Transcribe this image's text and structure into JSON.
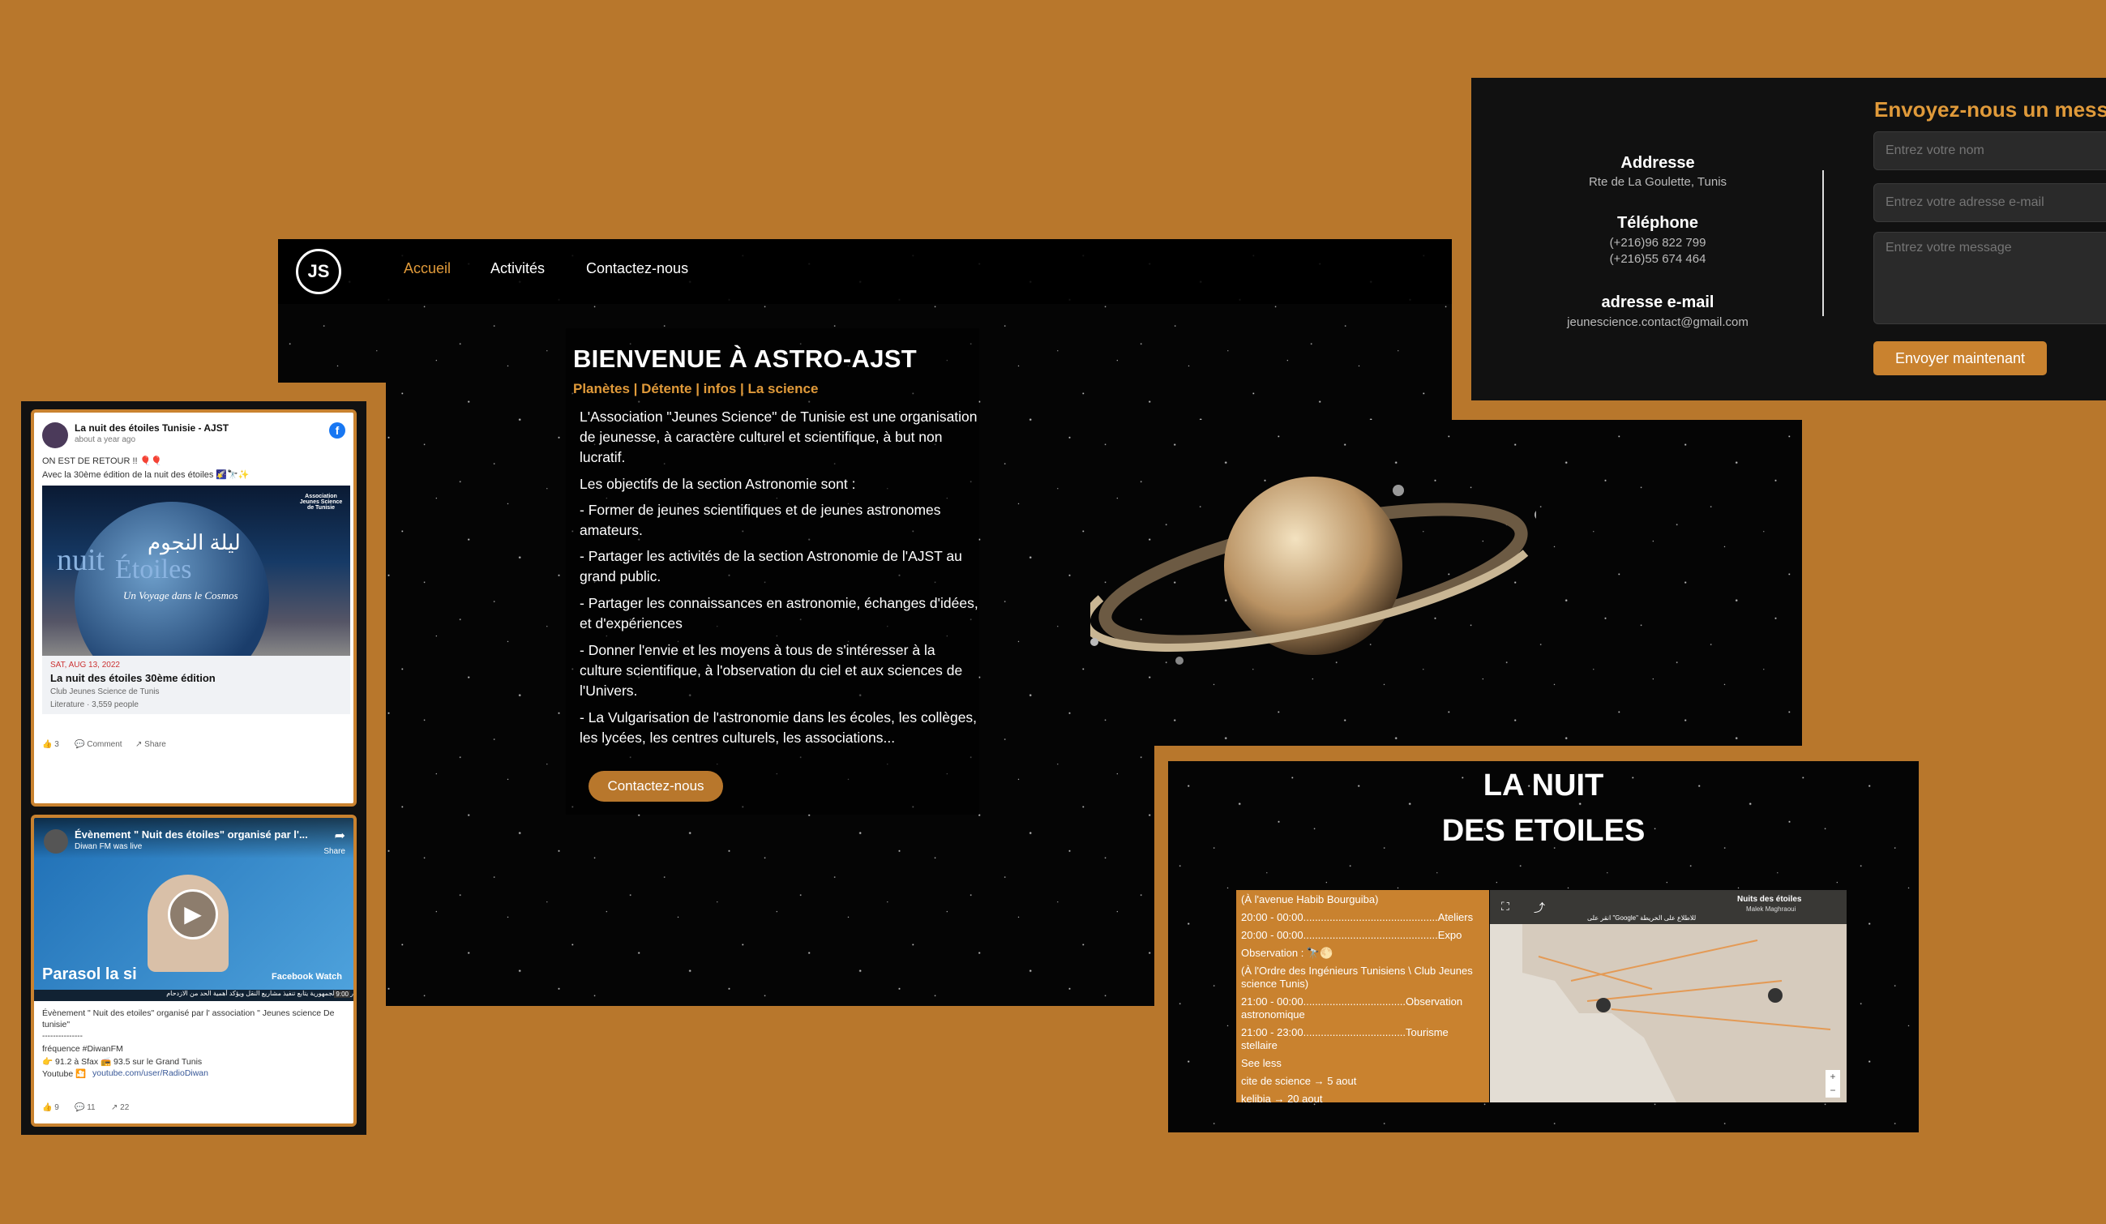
{
  "nav": {
    "logo": "JS",
    "items": [
      "Accueil",
      "Activités",
      "Contactez-nous"
    ]
  },
  "hero": {
    "title": "BIENVENUE À ASTRO-AJST",
    "tagline": "Planètes | Détente | infos | La science",
    "paragraphs": [
      "L'Association \"Jeunes Science\" de Tunisie est une organisation de jeunesse, à caractère culturel et scientifique, à but non lucratif.",
      "Les objectifs de la section Astronomie sont :",
      "- Former de jeunes scientifiques et de jeunes astronomes amateurs.",
      "- Partager les activités de la section Astronomie de l'AJST au grand public.",
      "- Partager les connaissances en astronomie, échanges d'idées, et d'expériences",
      "- Donner l'envie et les moyens à tous de s'intéresser à la culture scientifique, à l'observation du ciel et aux sciences de l'Univers.",
      "- La Vulgarisation de l'astronomie dans les écoles, les collèges, les lycées, les centres culturels, les associations..."
    ],
    "button": "Contactez-nous"
  },
  "contact": {
    "address_label": "Addresse",
    "address": "Rte de La Goulette, Tunis",
    "phone_label": "Téléphone",
    "phone1": "(+216)96 822 799",
    "phone2": "(+216)55 674 464",
    "email_label": "adresse e-mail",
    "email": "jeunescience.contact@gmail.com",
    "form_title": "Envoyez-nous un message",
    "name_placeholder": "Entrez votre nom",
    "email_placeholder": "Entrez votre adresse e-mail",
    "message_placeholder": "Entrez votre message",
    "send": "Envoyer maintenant"
  },
  "fb_post": {
    "page": "La nuit des étoiles Tunisie - AJST",
    "time": "about a year ago",
    "line1": "ON EST DE RETOUR !! 🎈🎈",
    "line2": "Avec la 30ème édition de la nuit des étoiles 🌠🔭✨",
    "img_arabic": "ليلة النجوم",
    "img_nuit": "nuit",
    "img_etoiles": "Étoiles",
    "img_sub": "Un Voyage dans le Cosmos",
    "img_assoc": "Association Jeunes Science de Tunisie",
    "date": "SAT, AUG 13, 2022",
    "event": "La nuit des étoiles 30ème édition",
    "org": "Club Jeunes Science de Tunis",
    "meta": "Literature · 3,559 people",
    "likes": "3",
    "comment": "Comment",
    "share": "Share"
  },
  "fb_video": {
    "title": "Évènement \" Nuit des étoiles\" organisé par l'...",
    "sub": "Diwan FM was live",
    "share": "Share",
    "brand": "Parasol la si",
    "watch": "Facebook Watch",
    "ticker": "رئيس الجمهورية يتابع تنفيذ مشاريع النقل ويؤكد أهمية الحد من الازدحام",
    "time": "9:00",
    "desc1": "Évènement \" Nuit des etoiles\" organisé par l' association \" Jeunes science De tunisie\"",
    "sep": "---------------",
    "freq": "fréquence #DiwanFM",
    "sfax": "👉 91.2 à Sfax 📻 93.5 sur le Grand Tunis",
    "yt_label": "Youtube 🎦",
    "yt_link": "youtube.com/user/RadioDiwan",
    "likes": "9",
    "comments": "11",
    "shares": "22"
  },
  "nuit": {
    "title1": "LA NUIT",
    "title2": "DES ETOILES",
    "schedule": [
      "(À l'avenue Habib Bourguiba)",
      "20:00 - 00:00..............................................Ateliers",
      "20:00 - 00:00..............................................Expo",
      "Observation : 🔭🌕",
      "(À l'Ordre des Ingénieurs Tunisiens \\ Club Jeunes science Tunis)",
      "21:00 - 00:00...................................Observation astronomique",
      "21:00 - 23:00...................................Tourisme stellaire",
      "See less",
      "cite de science → 5 aout",
      "kelibia → 20 aout"
    ],
    "map_title": "Nuits des étoiles",
    "map_author": "Malek Maghraoui",
    "map_note": "انقر على \"Google\" للاطلاع على الخريطة"
  }
}
